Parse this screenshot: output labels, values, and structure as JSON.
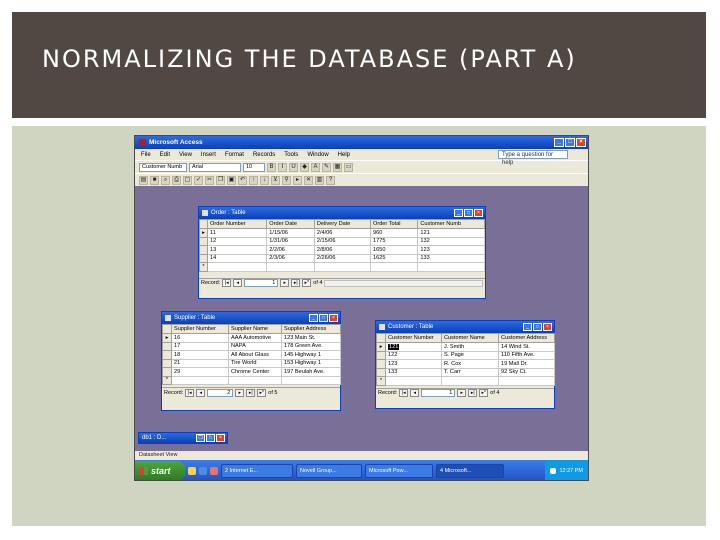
{
  "slide": {
    "title": "NORMALIZING THE DATABASE (PART A)"
  },
  "app": {
    "title": "Microsoft Access",
    "menu": [
      "File",
      "Edit",
      "View",
      "Insert",
      "Format",
      "Records",
      "Tools",
      "Window",
      "Help"
    ],
    "help_box": "Type a question for help",
    "toolbar": {
      "field_select": "Customer Numb",
      "font": "Arial",
      "size": "10"
    }
  },
  "order_table": {
    "title": "Order : Table",
    "columns": [
      "Order Number",
      "Order Date",
      "Delivery Date",
      "Order Total",
      "Customer Numb"
    ],
    "rows": [
      [
        "11",
        "1/15/06",
        "2/4/06",
        "960",
        "121"
      ],
      [
        "12",
        "1/31/06",
        "2/15/06",
        "1775",
        "132"
      ],
      [
        "13",
        "2/2/06",
        "2/8/06",
        "1650",
        "123"
      ],
      [
        "14",
        "2/3/06",
        "2/26/06",
        "1625",
        "133"
      ]
    ],
    "record_label": "Record:",
    "current": "1",
    "total": "of 4"
  },
  "supplier_table": {
    "title": "Supplier : Table",
    "columns": [
      "Supplier Number",
      "Supplier Name",
      "Supplier Address"
    ],
    "rows": [
      [
        "16",
        "AAA Automotive",
        "123 Main St."
      ],
      [
        "17",
        "NAPA",
        "178 Green Ave."
      ],
      [
        "18",
        "All About Glass",
        "145 Highway 1"
      ],
      [
        "21",
        "Tire World",
        "153 Highway 1"
      ],
      [
        "29",
        "Chrome Center",
        "197 Beulah Ave."
      ]
    ],
    "record_label": "Record:",
    "current": "2",
    "total": "of 5"
  },
  "customer_table": {
    "title": "Customer : Table",
    "columns": [
      "Customer Number",
      "Customer Name",
      "Customer Address"
    ],
    "rows": [
      [
        "121",
        "J. Smith",
        "14 Wind St."
      ],
      [
        "122",
        "S. Page",
        "110 Fifth Ave."
      ],
      [
        "123",
        "R. Cox",
        "19 Mall Dr."
      ],
      [
        "133",
        "T. Carr",
        "92 Sky Ct."
      ]
    ],
    "record_label": "Record:",
    "current": "1",
    "total": "of 4"
  },
  "minimized": {
    "title": "db1 : D..."
  },
  "status": "Datasheet View",
  "taskbar": {
    "start": "start",
    "tasks": [
      "2 Internet E...",
      "Novell Group...",
      "Microsoft Pow...",
      "4 Microsoft..."
    ],
    "clock": "12:27 PM"
  }
}
